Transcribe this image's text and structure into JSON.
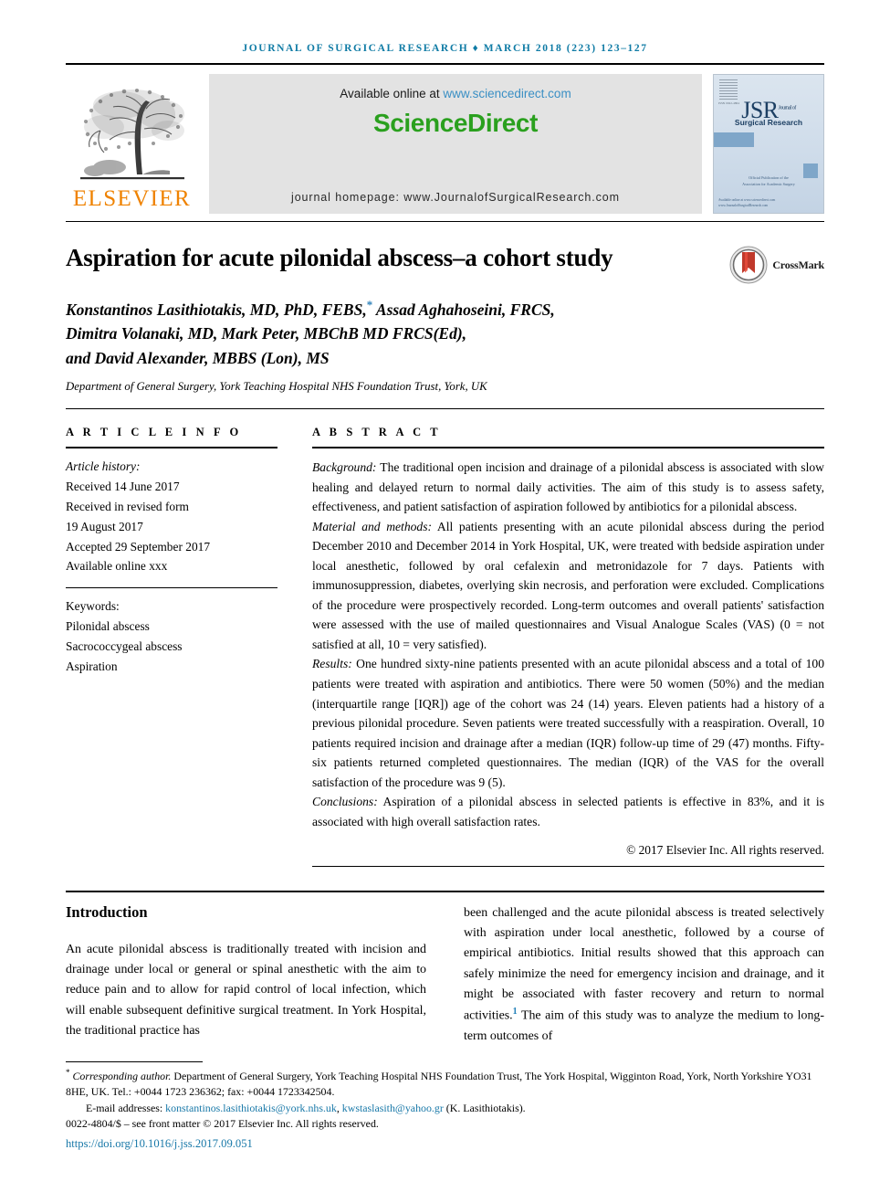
{
  "running_head": "JOURNAL OF SURGICAL RESEARCH ♦ MARCH 2018 (223) 123–127",
  "masthead": {
    "elsevier_wordmark": "ELSEVIER",
    "available_prefix": "Available online at ",
    "sciencedirect_url": "www.sciencedirect.com",
    "sciencedirect_brand": "ScienceDirect",
    "journal_homepage": "journal homepage: www.JournalofSurgicalResearch.com",
    "cover": {
      "title_main": "JSR",
      "title_sup": "Journal of",
      "title_sub": "Surgical Research",
      "mid_line_1": "Official Publication of the",
      "mid_line_2": "Association for Academic Surgery",
      "foot_line_1": "Available online at www.sciencedirect.com",
      "foot_line_2": "www.JournalofSurgicalResearch.com"
    }
  },
  "article": {
    "title": "Aspiration for acute pilonidal abscess–a cohort study",
    "crossmark_label": "CrossMark",
    "authors_line_1": "Konstantinos Lasithiotakis, MD, PhD, FEBS,",
    "authors_line_1b": " Assad Aghahoseini, FRCS,",
    "authors_line_2": "Dimitra Volanaki, MD, Mark Peter, MBChB MD FRCS(Ed),",
    "authors_line_3": "and David Alexander, MBBS (Lon), MS",
    "affiliation": "Department of General Surgery, York Teaching Hospital NHS Foundation Trust, York, UK"
  },
  "article_info": {
    "heading": "A R T I C L E  I N F O",
    "history_label": "Article history:",
    "history": [
      "Received 14 June 2017",
      "Received in revised form",
      "19 August 2017",
      "Accepted 29 September 2017",
      "Available online xxx"
    ],
    "keywords_label": "Keywords:",
    "keywords": [
      "Pilonidal abscess",
      "Sacrococcygeal abscess",
      "Aspiration"
    ]
  },
  "abstract": {
    "heading": "A B S T R A C T",
    "sections": [
      {
        "lead": "Background:",
        "text": " The traditional open incision and drainage of a pilonidal abscess is associated with slow healing and delayed return to normal daily activities. The aim of this study is to assess safety, effectiveness, and patient satisfaction of aspiration followed by antibiotics for a pilonidal abscess."
      },
      {
        "lead": "Material and methods:",
        "text": " All patients presenting with an acute pilonidal abscess during the period December 2010 and December 2014 in York Hospital, UK, were treated with bedside aspiration under local anesthetic, followed by oral cefalexin and metronidazole for 7 days. Patients with immunosuppression, diabetes, overlying skin necrosis, and perforation were excluded. Complications of the procedure were prospectively recorded. Long-term outcomes and overall patients' satisfaction were assessed with the use of mailed questionnaires and Visual Analogue Scales (VAS) (0 = not satisfied at all, 10 = very satisfied)."
      },
      {
        "lead": "Results:",
        "text": " One hundred sixty-nine patients presented with an acute pilonidal abscess and a total of 100 patients were treated with aspiration and antibiotics. There were 50 women (50%) and the median (interquartile range [IQR]) age of the cohort was 24 (14) years. Eleven patients had a history of a previous pilonidal procedure. Seven patients were treated successfully with a reaspiration. Overall, 10 patients required incision and drainage after a median (IQR) follow-up time of 29 (47) months. Fifty-six patients returned completed questionnaires. The median (IQR) of the VAS for the overall satisfaction of the procedure was 9 (5)."
      },
      {
        "lead": "Conclusions:",
        "text": " Aspiration of a pilonidal abscess in selected patients is effective in 83%, and it is associated with high overall satisfaction rates."
      }
    ],
    "copyright": "© 2017 Elsevier Inc. All rights reserved."
  },
  "introduction": {
    "heading": "Introduction",
    "left_text": "An acute pilonidal abscess is traditionally treated with incision and drainage under local or general or spinal anesthetic with the aim to reduce pain and to allow for rapid control of local infection, which will enable subsequent definitive surgical treatment. In York Hospital, the traditional practice has",
    "right_text_a": "been challenged and the acute pilonidal abscess is treated selectively with aspiration under local anesthetic, followed by a course of empirical antibiotics. Initial results showed that this approach can safely minimize the need for emergency incision and drainage, and it might be associated with faster recovery and return to normal activities.",
    "right_ref": "1",
    "right_text_b": " The aim of this study was to analyze the medium to long-term outcomes of"
  },
  "footnotes": {
    "corresponding_italic": "Corresponding author.",
    "corresponding_text": " Department of General Surgery, York Teaching Hospital NHS Foundation Trust, The York Hospital, Wigginton Road, York, North Yorkshire YO31 8HE, UK. Tel.: +0044 1723 236362; fax: +0044 1723342504.",
    "email_label": "E-mail addresses: ",
    "email_1": "konstantinos.lasithiotakis@york.nhs.uk",
    "email_sep": ", ",
    "email_2": "kwstaslasith@yahoo.gr",
    "email_suffix": " (K. Lasithiotakis).",
    "issn_line": "0022-4804/$ – see front matter © 2017 Elsevier Inc. All rights reserved.",
    "doi": "https://doi.org/10.1016/j.jss.2017.09.051"
  },
  "colors": {
    "runhead": "#0f7ba5",
    "elsevier_orange": "#ef8200",
    "sciencedirect_green": "#2aa01e",
    "link_blue": "#1878a8",
    "cover_blue": "#1c3f63"
  }
}
